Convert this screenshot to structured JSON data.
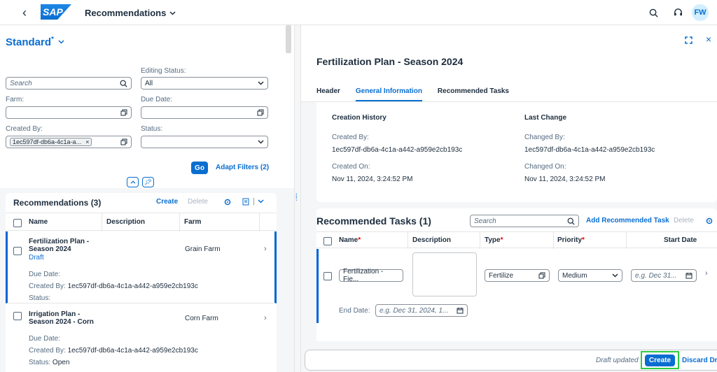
{
  "shell": {
    "back": "‹",
    "logo": "SAP",
    "app_title": "Recommendations",
    "avatar": "FW"
  },
  "variant": {
    "name": "Standard",
    "modified": "*"
  },
  "filters": {
    "search_placeholder": "Search",
    "editing_status_label": "Editing Status:",
    "editing_status_value": "All",
    "farm_label": "Farm:",
    "due_date_label": "Due Date:",
    "created_by_label": "Created By:",
    "created_by_token": "1ec597df-db6a-4c1a-a...",
    "status_label": "Status:",
    "go": "Go",
    "adapt": "Adapt Filters (2)"
  },
  "list": {
    "title": "Recommendations (3)",
    "create": "Create",
    "delete": "Delete",
    "columns": [
      "Name",
      "Description",
      "Farm"
    ],
    "rows": [
      {
        "name_line1": "Fertilization Plan -",
        "name_line2": "Season 2024",
        "state": "Draft",
        "farm": "Grain Farm",
        "due_label": "Due Date:",
        "created_label": "Created By:",
        "created_value": "1ec597df-db6a-4c1a-a442-a959e2cb193c",
        "status_label": "Status:",
        "status_value": ""
      },
      {
        "name_line1": "Irrigation Plan -",
        "name_line2": "Season 2024 - Corn",
        "state": "",
        "farm": "Corn Farm",
        "due_label": "Due Date:",
        "created_label": "Created By:",
        "created_value": "1ec597df-db6a-4c1a-a442-a959e2cb193c",
        "status_label": "Status:",
        "status_value": "Open"
      }
    ]
  },
  "detail": {
    "title": "Fertilization Plan - Season 2024",
    "tabs": [
      "Header",
      "General Information",
      "Recommended Tasks"
    ],
    "creation_history": "Creation History",
    "last_change": "Last Change",
    "created_by_label": "Created By:",
    "created_by": "1ec597df-db6a-4c1a-a442-a959e2cb193c",
    "changed_by_label": "Changed By:",
    "changed_by": "1ec597df-db6a-4c1a-a442-a959e2cb193c",
    "created_on_label": "Created On:",
    "created_on": "Nov 11, 2024, 3:24:52 PM",
    "changed_on_label": "Changed On:",
    "changed_on": "Nov 11, 2024, 3:24:52 PM"
  },
  "tasks": {
    "title": "Recommended Tasks (1)",
    "search_placeholder": "Search",
    "add": "Add Recommended Task",
    "delete": "Delete",
    "columns": {
      "name": "Name",
      "description": "Description",
      "type": "Type",
      "priority": "Priority",
      "start": "Start Date"
    },
    "req": "*",
    "row": {
      "name": "Fertilization - Fie...",
      "type": "Fertilize",
      "priority": "Medium",
      "start_ph": "e.g. Dec 31...",
      "end_label": "End Date:",
      "end_ph": "e.g. Dec 31, 2024, 1..."
    }
  },
  "footer": {
    "status": "Draft updated",
    "create": "Create",
    "discard": "Discard Draft"
  },
  "colors": {
    "brand": "#0a6ed1",
    "highlight": "#2ecc40",
    "selection": "#0064d9"
  }
}
